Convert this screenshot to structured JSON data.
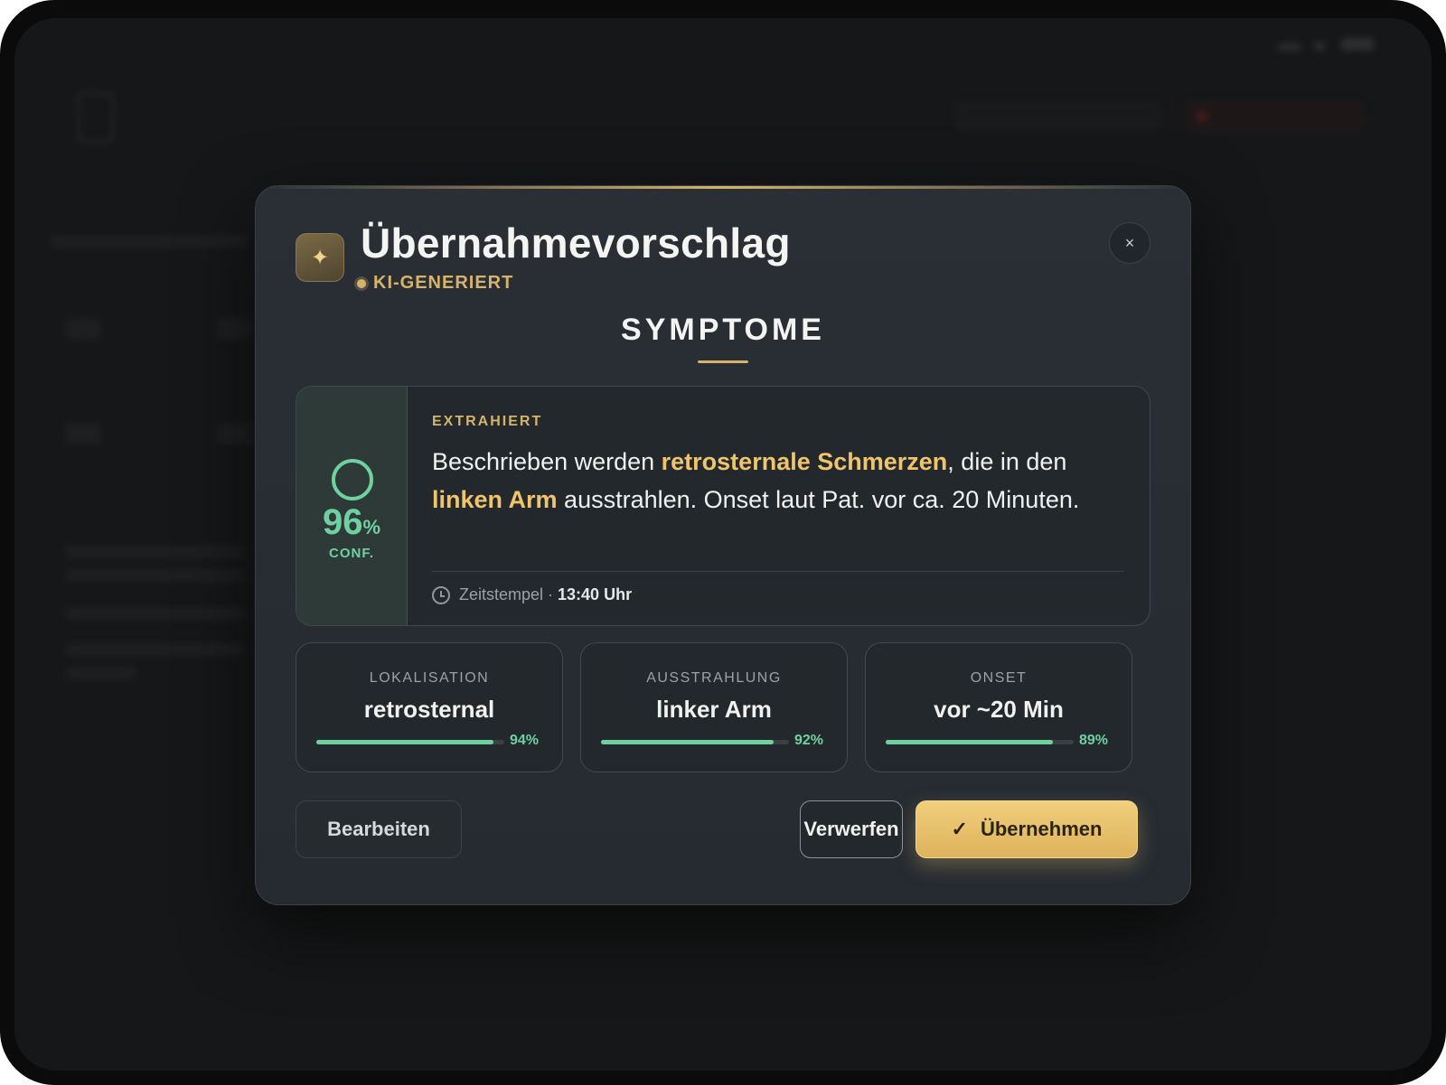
{
  "dialog": {
    "title": "Übernahmevorschlag",
    "tag": "KI-GENERIERT",
    "close_icon": "×",
    "section_title": "SYMPTOME"
  },
  "extraction": {
    "eyebrow": "EXTRAHIERT",
    "confidence": {
      "value": "96",
      "unit": "%",
      "label": "CONF."
    },
    "text_parts": [
      "Beschrieben werden ",
      "retrosternale Schmerzen",
      ", die in den ",
      "linken Arm",
      " ausstrahlen. Onset laut Pat. vor ca. 20 Minuten."
    ],
    "timestamp_label": "Zeitstempel · ",
    "timestamp_value": "13:40 Uhr"
  },
  "metrics": [
    {
      "label": "LOKALISATION",
      "value": "retrosternal",
      "percent": "94%",
      "fraction": 0.94
    },
    {
      "label": "AUSSTRAHLUNG",
      "value": "linker Arm",
      "percent": "92%",
      "fraction": 0.92
    },
    {
      "label": "ONSET",
      "value": "vor ~20 Min",
      "percent": "89%",
      "fraction": 0.89
    }
  ],
  "buttons": {
    "edit": "Bearbeiten",
    "discard": "Verwerfen",
    "accept": "Übernehmen"
  },
  "colors": {
    "accent_gold": "#d6b36a",
    "confidence_green": "#6fd1a0"
  }
}
